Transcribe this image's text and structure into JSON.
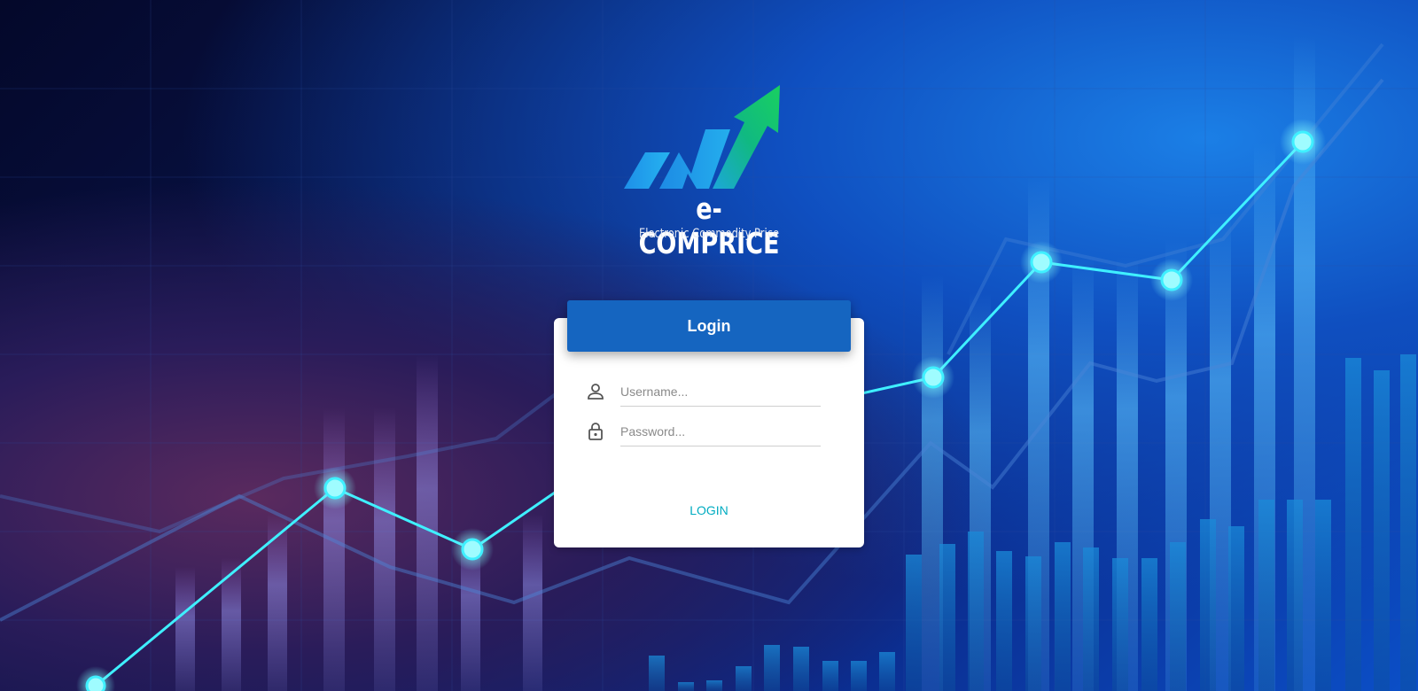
{
  "brand": {
    "name": "e-COMPRICE",
    "tagline": "Electronic Commodity Price"
  },
  "login_card": {
    "title": "Login",
    "username_placeholder": "Username...",
    "password_placeholder": "Password...",
    "submit_label": "LOGIN"
  },
  "icons": {
    "username": "person-icon",
    "password": "lock-icon"
  },
  "colors": {
    "header": "#1565c0",
    "submit_text": "#00acc1",
    "chart_line": "#3ff0ff"
  }
}
